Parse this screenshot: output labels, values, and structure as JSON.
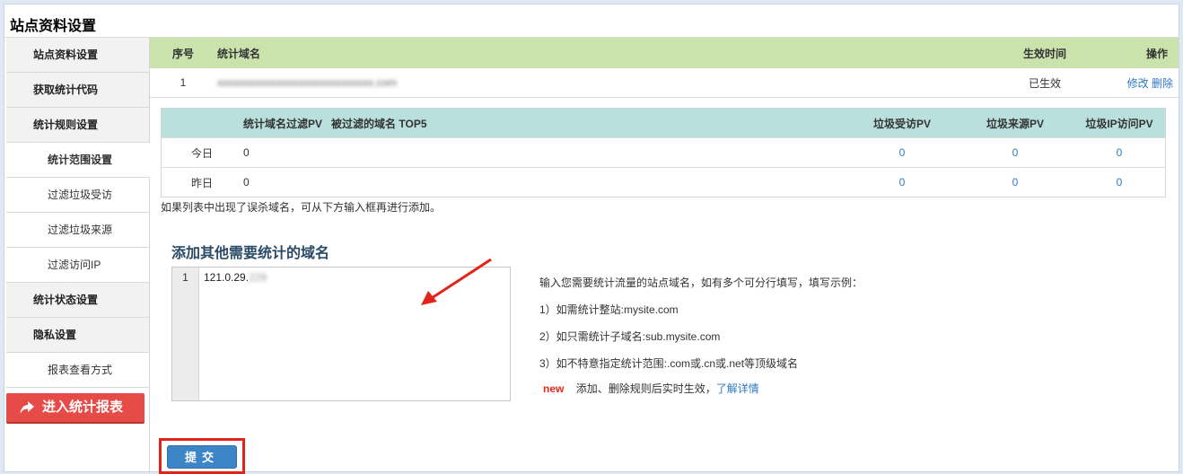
{
  "page_title": "站点资料设置",
  "sidebar": {
    "items": [
      {
        "label": "站点资料设置",
        "type": "parent"
      },
      {
        "label": "获取统计代码",
        "type": "parent"
      },
      {
        "label": "统计规则设置",
        "type": "parent"
      },
      {
        "label": "统计范围设置",
        "type": "child-active"
      },
      {
        "label": "过滤垃圾受访",
        "type": "child"
      },
      {
        "label": "过滤垃圾来源",
        "type": "child"
      },
      {
        "label": "过滤访问IP",
        "type": "child"
      },
      {
        "label": "统计状态设置",
        "type": "parent"
      },
      {
        "label": "隐私设置",
        "type": "parent"
      },
      {
        "label": "报表查看方式",
        "type": "child"
      }
    ],
    "enter_report": "进入统计报表"
  },
  "domain_table": {
    "headers": {
      "index": "序号",
      "domain": "统计域名",
      "effective": "生效时间",
      "action": "操作"
    },
    "rows": [
      {
        "index": "1",
        "domain": "xxxxxxxxxxxxxxxxxxxxxxxxxxxxx.com",
        "effective": "已生效",
        "edit": "修改",
        "delete": "删除"
      }
    ]
  },
  "stat_table": {
    "headers": {
      "filtered": "统计域名过滤PV",
      "top5": "被过滤的域名 TOP5",
      "junk_visit": "垃圾受访PV",
      "junk_source": "垃圾来源PV",
      "junk_ip": "垃圾IP访问PV"
    },
    "rows": [
      {
        "label": "今日",
        "filtered": "0",
        "junk_visit": "0",
        "junk_source": "0",
        "junk_ip": "0"
      },
      {
        "label": "昨日",
        "filtered": "0",
        "junk_visit": "0",
        "junk_source": "0",
        "junk_ip": "0"
      }
    ]
  },
  "hint": "如果列表中出现了误杀域名，可从下方输入框再进行添加。",
  "add_section": {
    "title": "添加其他需要统计的域名",
    "line_number": "1",
    "input_value_visible": "121.0.29.",
    "input_value_blurred": "229"
  },
  "instructions": {
    "intro": "输入您需要统计流量的站点域名，如有多个可分行填写，填写示例：",
    "ex1": "1）如需统计整站:mysite.com",
    "ex2": "2）如只需统计子域名:sub.mysite.com",
    "ex3": "3）如不特意指定统计范围:.com或.cn或.net等顶级域名",
    "new_badge": "new",
    "note": "添加、删除规则后实时生效，",
    "more_link": "了解详情"
  },
  "submit_label": "提交",
  "colors": {
    "domain_header": "#cae3ac",
    "stat_header": "#b9e0dd",
    "link": "#2f78c4",
    "enter_report_bg": "#e74b47",
    "submit_bg": "#3c86c7",
    "annotation_red": "#e2231a"
  }
}
